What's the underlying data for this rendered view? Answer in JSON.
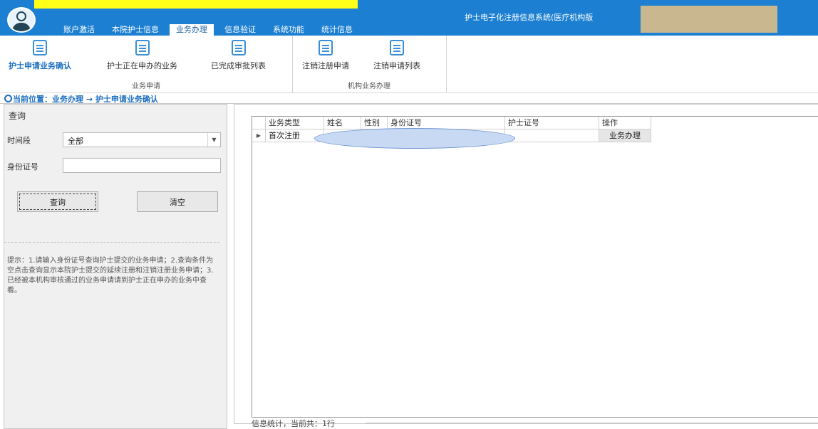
{
  "window": {
    "app_title": "护士电子化注册信息系统(医疗机构版",
    "tabs": [
      "账户激活",
      "本院护士信息",
      "业务办理",
      "信息验证",
      "系统功能",
      "统计信息"
    ],
    "active_tab_index": 2
  },
  "ribbon": {
    "groups": [
      {
        "name": "业务申请",
        "buttons": [
          "护士申请业务确认",
          "护士正在申办的业务",
          "已完成审批列表"
        ]
      },
      {
        "name": "机构业务办理",
        "buttons": [
          "注销注册申请",
          "注销申请列表"
        ]
      }
    ],
    "selected_button": "护士申请业务确认"
  },
  "breadcrumb": "当前位置：业务办理 → 护士申请业务确认",
  "query_panel": {
    "title": "查询",
    "period_label": "时间段",
    "period_value": "全部",
    "id_label": "身份证号",
    "id_value": "",
    "query_button": "查询",
    "clear_button": "清空",
    "hint": "提示：1.请输入身份证号查询护士提交的业务申请；2.查询条件为空点击查询显示本院护士提交的延续注册和注销注册业务申请；3.已经被本机构审核通过的业务申请请到护士正在申办的业务中查看。"
  },
  "grid": {
    "columns": [
      "业务类型",
      "姓名",
      "性别",
      "身份证号",
      "护士证号",
      "操作"
    ],
    "rows": [
      {
        "type": "首次注册",
        "name": "",
        "gender": "",
        "id_number": "",
        "nurse_cert": "",
        "action": "业务办理"
      }
    ]
  },
  "status": "信息统计，当前共：1行",
  "colors": {
    "title_bar": "#1c7fd1",
    "accent": "#1d6fc0",
    "panel_bg": "#f0f0f0"
  }
}
